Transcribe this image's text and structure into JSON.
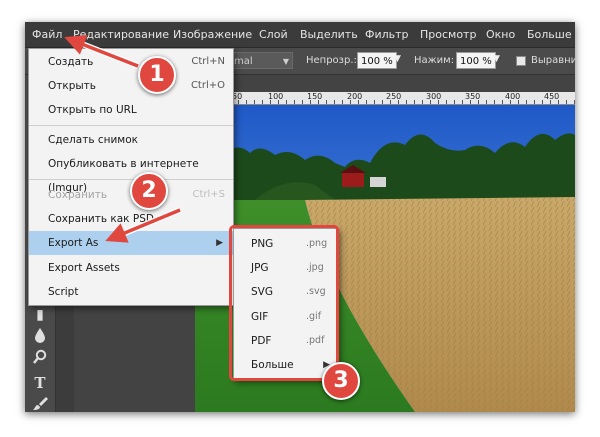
{
  "menubar": {
    "items": [
      "Файл",
      "Редактирование",
      "Изображение",
      "Слой",
      "Выделить",
      "Фильтр",
      "Просмотр",
      "Окно",
      "Больше"
    ]
  },
  "options_bar": {
    "blend_mode_partial": "mal",
    "opacity_label": "Непрозр.:",
    "opacity_value": "100 %",
    "pressure_label": "Нажим:",
    "pressure_value": "100 %",
    "align_label": "Выравни"
  },
  "ruler": {
    "ticks": [
      "50",
      "100",
      "150",
      "200",
      "250",
      "300",
      "350",
      "400",
      "450"
    ]
  },
  "file_menu": {
    "items": [
      {
        "label": "Создать",
        "shortcut": "Ctrl+N"
      },
      {
        "label": "Открыть",
        "shortcut": "Ctrl+O"
      },
      {
        "label": "Открыть по URL",
        "shortcut": ""
      },
      {
        "label": "Сделать снимок",
        "shortcut": ""
      },
      {
        "label": "Опубликовать в интернете (Imgur)",
        "shortcut": ""
      },
      {
        "label": "Сохранить",
        "shortcut": "Ctrl+S",
        "disabled": true
      },
      {
        "label": "Сохранить как PSD",
        "shortcut": ""
      },
      {
        "label": "Export As",
        "shortcut": "",
        "submenu": true,
        "highlighted": true
      },
      {
        "label": "Export Assets",
        "shortcut": ""
      },
      {
        "label": "Script",
        "shortcut": ""
      }
    ]
  },
  "export_menu": {
    "items": [
      {
        "label": "PNG",
        "ext": ".png"
      },
      {
        "label": "JPG",
        "ext": ".jpg"
      },
      {
        "label": "SVG",
        "ext": ".svg"
      },
      {
        "label": "GIF",
        "ext": ".gif"
      },
      {
        "label": "PDF",
        "ext": ".pdf"
      },
      {
        "label": "Больше",
        "ext": "",
        "submenu": true
      }
    ]
  },
  "annotations": {
    "step1": "1",
    "step2": "2",
    "step3": "3"
  },
  "colors": {
    "annotation_red": "#e0473e",
    "menu_highlight": "#aed0ef",
    "app_background": "#434343"
  },
  "icons": {
    "submenu_arrow": "▶",
    "dropdown_arrow": "▼",
    "toolbar": [
      "eraser-icon",
      "drop-icon",
      "magnifier-icon",
      "text-tool-icon",
      "brush-icon"
    ]
  }
}
